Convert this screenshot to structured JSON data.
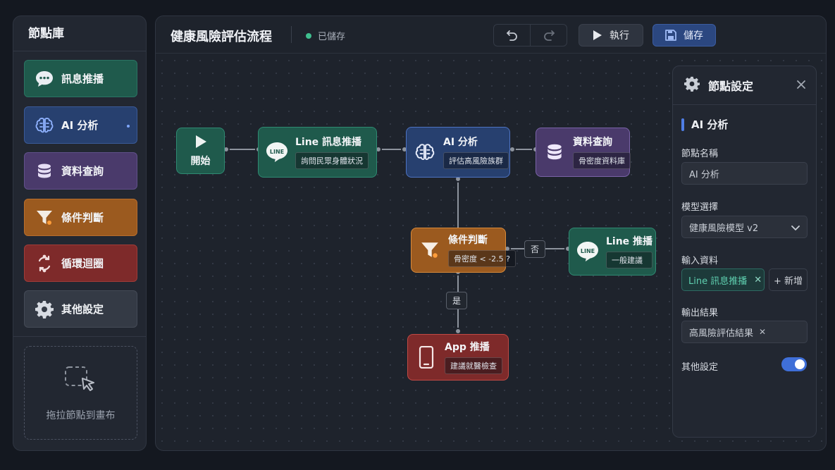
{
  "palette": {
    "title": "節點庫",
    "items": [
      {
        "label": "訊息推播",
        "color": "#1f5a4c",
        "icon": "chat-bubble-icon"
      },
      {
        "label": "AI 分析",
        "color": "#27406f",
        "icon": "brain-icon"
      },
      {
        "label": "資料查詢",
        "color": "#4a3a6b",
        "icon": "database-icon"
      },
      {
        "label": "條件判斷",
        "color": "#9b5a1f",
        "icon": "filter-icon"
      },
      {
        "label": "循環迴圈",
        "color": "#7e2a2a",
        "icon": "loop-icon"
      },
      {
        "label": "其他設定",
        "color": "#343a45",
        "icon": "gear-icon"
      }
    ],
    "dropzone_label": "拖拉節點到畫布"
  },
  "header": {
    "title": "健康風險評估流程",
    "status": "已儲存",
    "run_label": "執行",
    "save_label": "儲存"
  },
  "nodes": {
    "start": {
      "title": "開始"
    },
    "line_msg": {
      "title": "Line 訊息推播",
      "sub": "詢問民眾身體狀況"
    },
    "ai": {
      "title": "AI 分析",
      "sub": "評估高風險族群"
    },
    "query": {
      "title": "資料查詢",
      "sub": "骨密度資料庫"
    },
    "cond": {
      "title": "條件判斷",
      "sub": "骨密度 < -2.5 ?"
    },
    "line_push": {
      "title": "Line 推播",
      "sub": "一般建議"
    },
    "app_push": {
      "title": "App 推播",
      "sub": "建議就醫檢查"
    }
  },
  "edges": {
    "no_label": "否",
    "yes_label": "是"
  },
  "settings": {
    "title": "節點設定",
    "section": "AI 分析",
    "name_label": "節點名稱",
    "name_value": "AI 分析",
    "model_label": "模型選擇",
    "model_value": "健康風險模型 v2",
    "input_label": "輸入資料",
    "input_chip": "Line 訊息推播",
    "add_label": "+ 新增",
    "output_label": "輸出結果",
    "output_value": "高風險評估結果",
    "other_label": "其他設定",
    "other_enabled": true
  }
}
